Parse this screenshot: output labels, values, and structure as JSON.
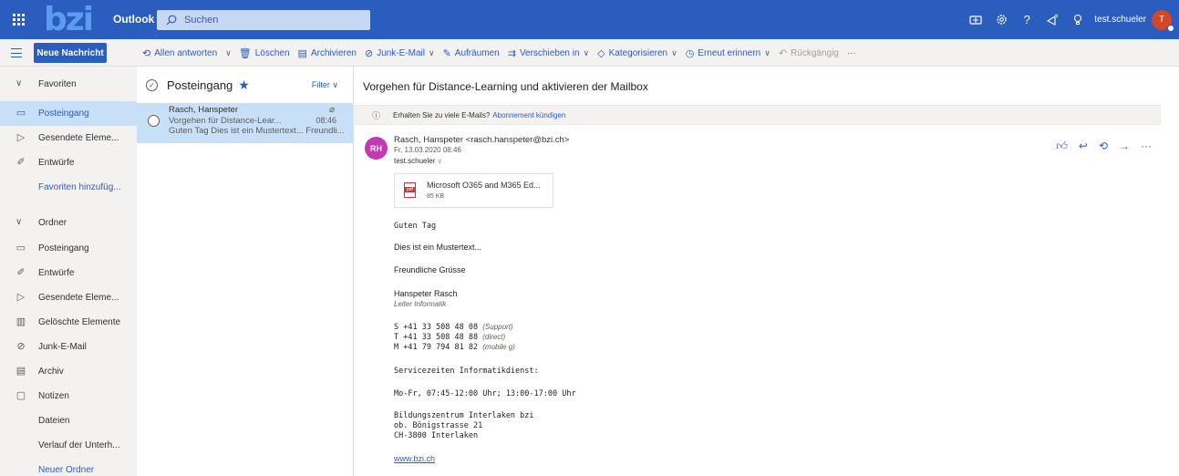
{
  "topbar": {
    "logo": "bzi",
    "app_name": "Outlook",
    "search_placeholder": "Suchen",
    "user_name": "test.schueler",
    "avatar_initial": "T"
  },
  "commands": {
    "new_message": "Neue Nachricht",
    "reply_all": "Allen antworten",
    "delete": "Löschen",
    "archive": "Archivieren",
    "junk": "Junk-E-Mail",
    "sweep": "Aufräumen",
    "move_to": "Verschieben in",
    "categorize": "Kategorisieren",
    "snooze": "Erneut erinnern",
    "undo": "Rückgängig",
    "more": "···"
  },
  "nav": {
    "favorites_header": "Favoriten",
    "favorites": [
      {
        "label": "Posteingang"
      },
      {
        "label": "Gesendete Eleme..."
      },
      {
        "label": "Entwürfe"
      }
    ],
    "add_favorite": "Favoriten hinzufüg...",
    "folders_header": "Ordner",
    "folders": [
      {
        "label": "Posteingang"
      },
      {
        "label": "Entwürfe"
      },
      {
        "label": "Gesendete Eleme..."
      },
      {
        "label": "Gelöschte Elemente"
      },
      {
        "label": "Junk-E-Mail"
      },
      {
        "label": "Archiv"
      },
      {
        "label": "Notizen"
      },
      {
        "label": "Dateien"
      },
      {
        "label": "Verlauf der Unterh..."
      }
    ],
    "new_folder": "Neuer Ordner"
  },
  "list": {
    "title": "Posteingang",
    "filter": "Filter",
    "messages": [
      {
        "sender": "Rasch, Hanspeter",
        "subject": "Vorgehen für Distance-Lear...",
        "preview": "Guten Tag Dies ist ein Mustertext... Freundli...",
        "time": "08:46"
      }
    ]
  },
  "reading": {
    "subject": "Vorgehen für Distance-Learning und aktivieren der Mailbox",
    "notice_text": "Erhalten Sie zu viele E-Mails?",
    "notice_link": "Abonnement kündigen",
    "avatar_initials": "RH",
    "from": "Rasch, Hanspeter <rasch.hanspeter@bzi.ch>",
    "date": "Fr, 13.03.2020 08:46",
    "to": "test.schueler",
    "attachment_name": "Microsoft O365 and M365 Ed...",
    "attachment_size": "85 KB",
    "body": {
      "greeting": "Guten Tag",
      "line1": "Dies ist ein Mustertext...",
      "closing": "Freundliche Grüsse",
      "sig_name": "Hanspeter Rasch",
      "sig_title": "Leiter Informatik",
      "phone_s": "S +41 33 508 48 08",
      "phone_s_note": "(Support)",
      "phone_t": "T +41 33 508 48 88",
      "phone_t_note": "(direct)",
      "phone_m": "M +41 79 794 81 82",
      "phone_m_note": "(mobile g)",
      "service_header": "Servicezeiten Informatikdienst:",
      "service_hours": "Mo-Fr, 07:45-12:00 Uhr; 13:00-17:00 Uhr",
      "org": "Bildungszentrum Interlaken bzi",
      "street": "ob. Bönigstrasse 21",
      "city": "CH-3800 Interlaken",
      "website": "www.bzi.ch"
    }
  },
  "colors": {
    "brand": "#2b5dbf",
    "selected": "#c7dff7",
    "avatar_rh": "#c239b3",
    "avatar_user": "#d24726"
  }
}
